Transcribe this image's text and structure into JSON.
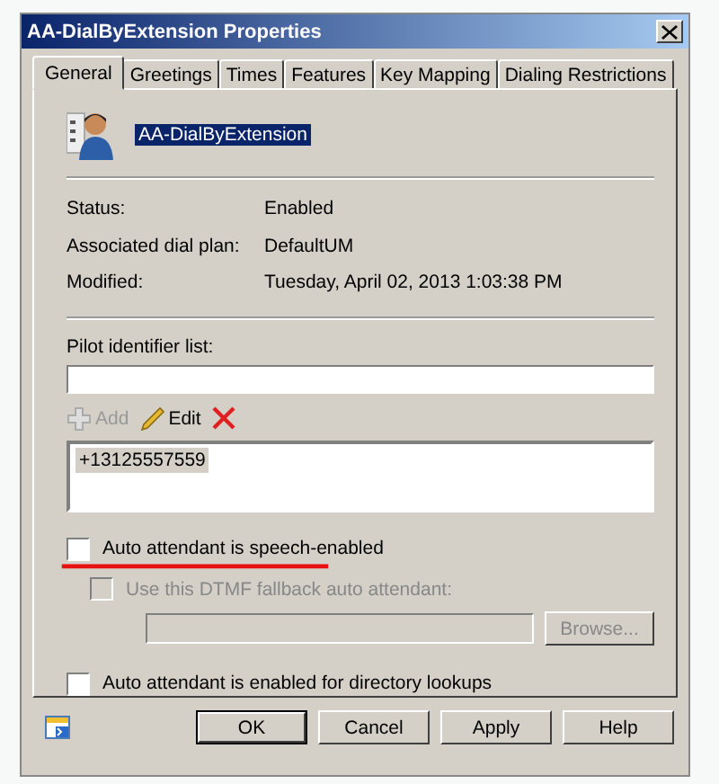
{
  "window": {
    "title": "AA-DialByExtension Properties"
  },
  "tabs": [
    {
      "label": "General",
      "selected": true
    },
    {
      "label": "Greetings",
      "selected": false
    },
    {
      "label": "Times",
      "selected": false
    },
    {
      "label": "Features",
      "selected": false
    },
    {
      "label": "Key Mapping",
      "selected": false
    },
    {
      "label": "Dialing Restrictions",
      "selected": false
    }
  ],
  "header": {
    "name": "AA-DialByExtension",
    "selected": true
  },
  "info": [
    {
      "label": "Status:",
      "value": "Enabled"
    },
    {
      "label": "Associated dial plan:",
      "value": "DefaultUM"
    },
    {
      "label": "Modified:",
      "value": "Tuesday, April 02, 2013 1:03:38 PM"
    }
  ],
  "pilot": {
    "label": "Pilot identifier list:",
    "toolbar": [
      {
        "kind": "add",
        "label": "Add",
        "disabled": true
      },
      {
        "kind": "edit",
        "label": "Edit",
        "disabled": false
      },
      {
        "kind": "delete",
        "disabled": false
      }
    ],
    "items": [
      {
        "text": "+13125557559",
        "selected": true
      }
    ]
  },
  "speech_enabled": {
    "label": "Auto attendant is speech-enabled",
    "checked": false,
    "disabled": false,
    "underlined": true
  },
  "dtmf_fallback": {
    "label": "Use this DTMF fallback auto attendant:",
    "checked": false,
    "disabled": true
  },
  "browse": {
    "label": "Browse...",
    "disabled": true
  },
  "directory_lookups": {
    "label": "Auto attendant is enabled for directory lookups",
    "checked": false,
    "disabled": false
  },
  "buttons": [
    {
      "label": "OK",
      "default": true
    },
    {
      "label": "Cancel",
      "default": false
    },
    {
      "label": "Apply",
      "default": false
    },
    {
      "label": "Help",
      "default": false
    }
  ]
}
